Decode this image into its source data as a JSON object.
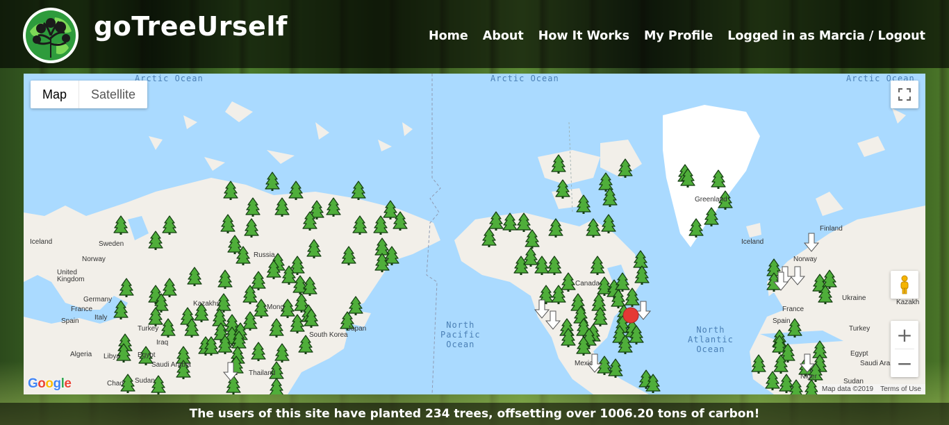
{
  "header": {
    "site_title": "goTreeUrself",
    "nav": {
      "home": "Home",
      "about": "About",
      "how_it_works": "How It Works",
      "my_profile": "My Profile",
      "account": "Logged in as Marcia / Logout"
    }
  },
  "map": {
    "map_type_map": "Map",
    "map_type_satellite": "Satellite",
    "google_logo": "Google",
    "attribution_data": "Map data ©2019",
    "attribution_terms": "Terms of Use",
    "ocean_labels": {
      "arctic_1": "Arctic Ocean",
      "arctic_2": "Arctic Ocean",
      "arctic_3": "Arctic Ocean",
      "north_pacific": "North\nPacific\nOcean",
      "north_atlantic": "North\nAtlantic\nOcean"
    },
    "place_labels": {
      "iceland_1": "Iceland",
      "sweden": "Sweden",
      "norway_1": "Norway",
      "uk": "United\nKingdom",
      "germany": "Germany",
      "france_1": "France",
      "spain_1": "Spain",
      "italy": "Italy",
      "turkey_1": "Turkey",
      "iraq": "Iraq",
      "algeria": "Algeria",
      "libya": "Libya",
      "egypt_1": "Egypt",
      "saudi_1": "Saudi Arabia",
      "sudan": "Sudan",
      "chad": "Chad",
      "kazakhstan_1": "Kazakhs",
      "mongolia": "Mong",
      "russia": "Russia",
      "south_korea": "South Korea",
      "japan": "Japan",
      "thailand": "Thailand",
      "greenland": "Greenland",
      "canada": "Canada",
      "mexico": "Mexic",
      "iceland_2": "Iceland",
      "finland": "Finland",
      "norway_2": "Norway",
      "france_2": "France",
      "spain_2": "Spain",
      "ukraine": "Ukraine",
      "turkey_2": "Turkey",
      "egypt_2": "Egypt",
      "saudi_2": "Saudi Arabia",
      "niger": "Niger",
      "sudan_2": "Sudan",
      "kazakhstan_2": "Kazakh"
    }
  },
  "footer": {
    "text": "The users of this site have planted 234 trees, offsetting over 1006.20 tons of carbon!"
  },
  "colors": {
    "ocean": "#aadaff",
    "land": "#f2efe9",
    "tree_marker": "#4fae3a",
    "location_marker": "#e53935"
  },
  "icons": [
    "tree-marker-icon",
    "arrow-marker-icon",
    "location-pin-icon",
    "fullscreen-icon",
    "pegman-icon",
    "zoom-in-icon",
    "zoom-out-icon",
    "logo-tree-globe-icon"
  ]
}
